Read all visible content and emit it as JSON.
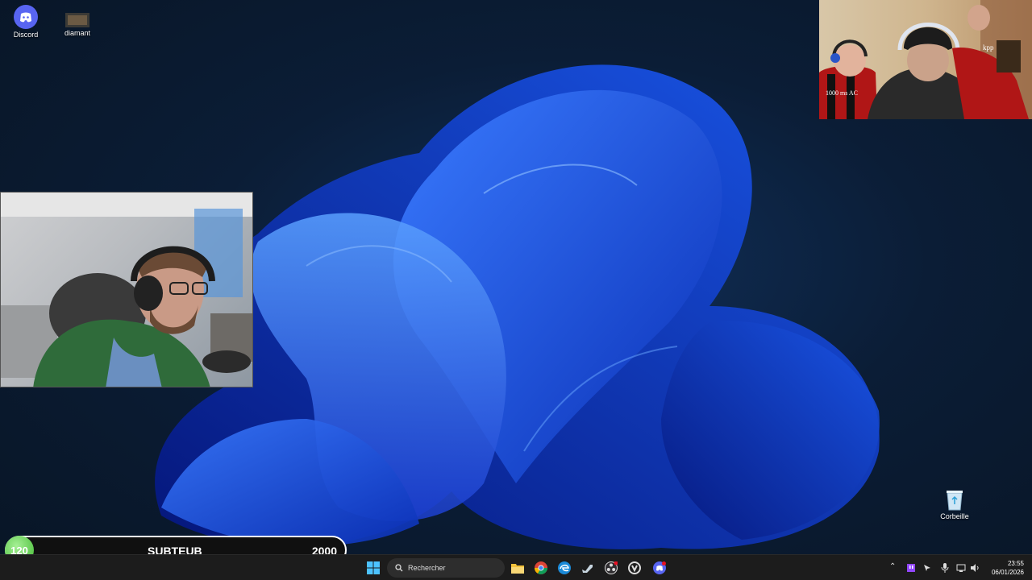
{
  "desktop": {
    "icons": [
      {
        "label": "Discord",
        "icon": "discord-icon"
      },
      {
        "label": "diamant",
        "icon": "image-file-icon"
      },
      {
        "label": "Corbeille",
        "icon": "recycle-bin-icon"
      }
    ]
  },
  "overlay": {
    "level": "120",
    "name": "SUBTEUB",
    "goal": "2000",
    "accent": "#5dc84d"
  },
  "cam_right": {
    "shirt_text": "1000 ms AC",
    "book_text": "kpp"
  },
  "taskbar": {
    "search_placeholder": "Rechercher",
    "pinned": [
      "windows-start-icon",
      "file-explorer-icon",
      "chrome-icon",
      "edge-icon",
      "steam-icon",
      "obs-icon",
      "overwatch-icon",
      "discord-icon"
    ],
    "clock_time": "23:55",
    "clock_date": "06/01/2026"
  }
}
